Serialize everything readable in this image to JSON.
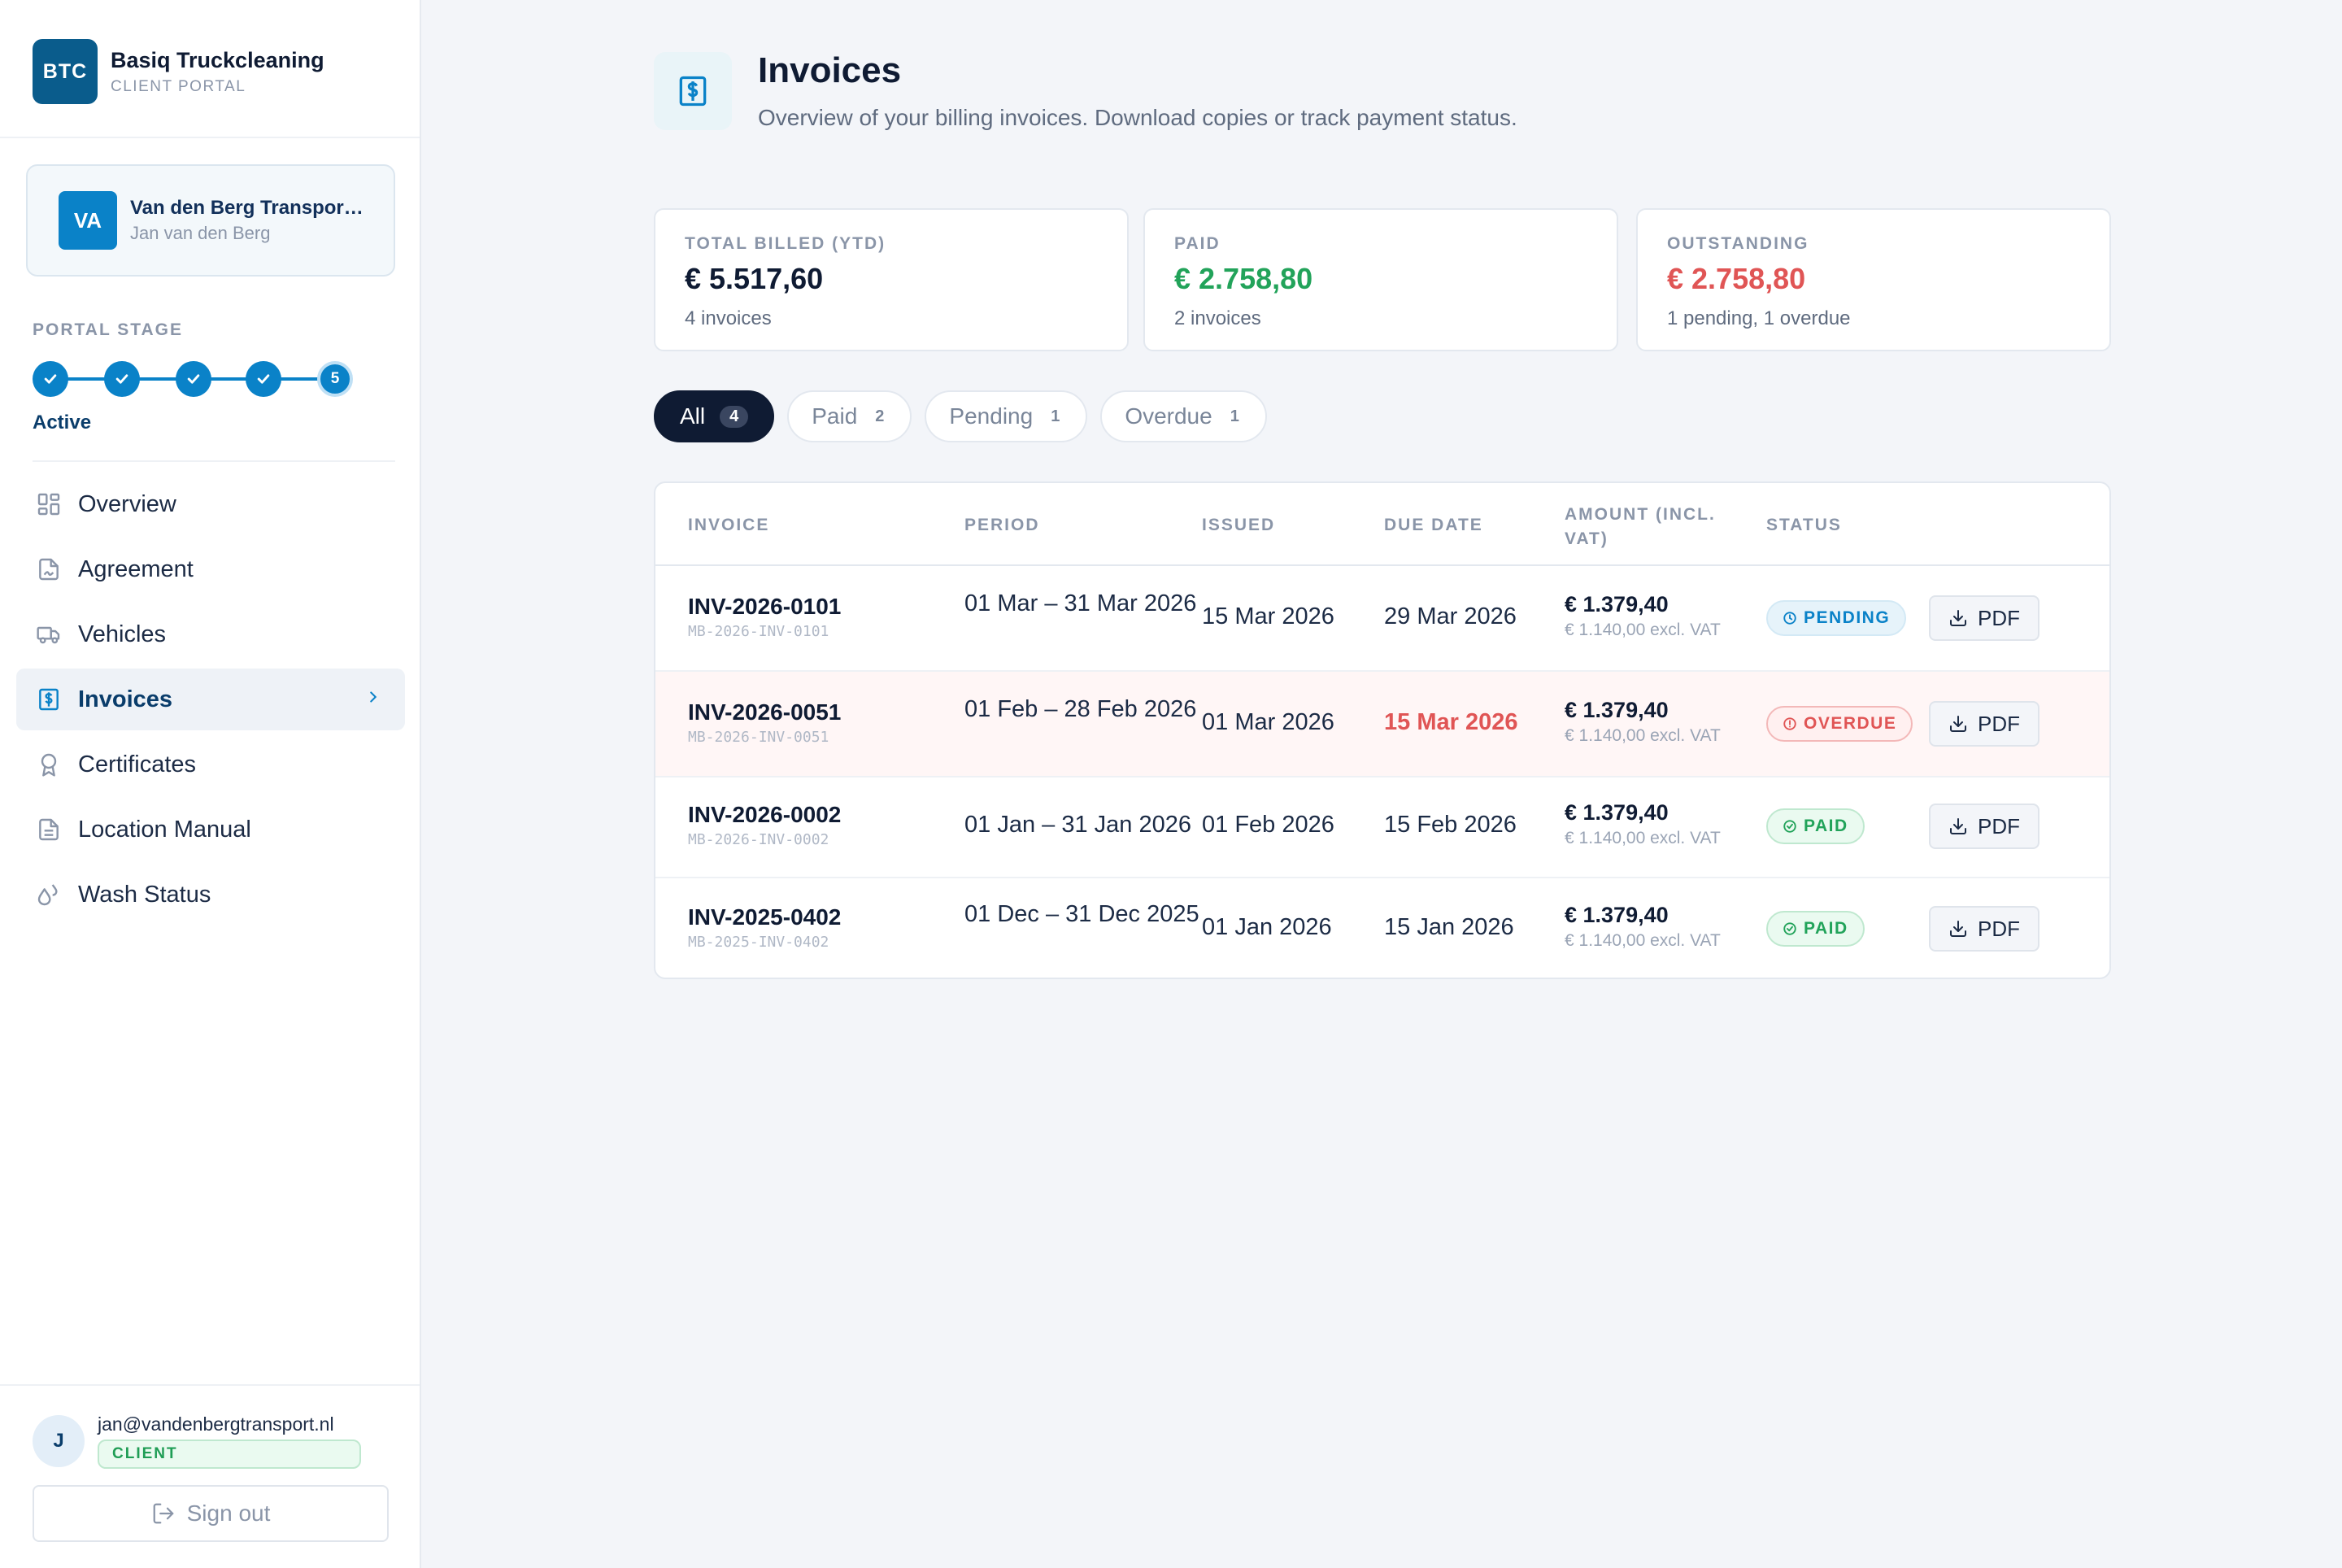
{
  "brand": {
    "logo": "BTC",
    "name": "Basiq Truckcleaning",
    "subtitle": "CLIENT PORTAL"
  },
  "client": {
    "initials": "VA",
    "company": "Van den Berg Transport B.V.",
    "contact": "Jan van den Berg"
  },
  "stage": {
    "label": "PORTAL STAGE",
    "current_step": "5",
    "status": "Active",
    "steps_completed": 4,
    "steps_total": 5
  },
  "nav": {
    "items": [
      {
        "label": "Overview",
        "icon": "grid-icon"
      },
      {
        "label": "Agreement",
        "icon": "signed-document-icon"
      },
      {
        "label": "Vehicles",
        "icon": "truck-icon"
      },
      {
        "label": "Invoices",
        "icon": "receipt-dollar-icon",
        "active": true
      },
      {
        "label": "Certificates",
        "icon": "award-icon"
      },
      {
        "label": "Location Manual",
        "icon": "document-icon"
      },
      {
        "label": "Wash Status",
        "icon": "droplets-icon"
      }
    ]
  },
  "user": {
    "initial": "J",
    "email": "jan@vandenbergtransport.nl",
    "role": "CLIENT",
    "signout_label": "Sign out"
  },
  "page": {
    "title": "Invoices",
    "description": "Overview of your billing invoices. Download copies or track payment status."
  },
  "stats": [
    {
      "label": "TOTAL BILLED (YTD)",
      "value": "€ 5.517,60",
      "note": "4 invoices",
      "color": "#0f1b33"
    },
    {
      "label": "PAID",
      "value": "€ 2.758,80",
      "note": "2 invoices",
      "color": "#22a35a"
    },
    {
      "label": "OUTSTANDING",
      "value": "€ 2.758,80",
      "note": "1 pending, 1 overdue",
      "color": "#e05555"
    }
  ],
  "filters": [
    {
      "label": "All",
      "count": "4",
      "active": true
    },
    {
      "label": "Paid",
      "count": "2"
    },
    {
      "label": "Pending",
      "count": "1"
    },
    {
      "label": "Overdue",
      "count": "1"
    }
  ],
  "table": {
    "headers": {
      "invoice": "INVOICE",
      "period": "PERIOD",
      "issued": "ISSUED",
      "due": "DUE DATE",
      "amount": "AMOUNT (INCL. VAT)",
      "status": "STATUS"
    },
    "pdf_label": "PDF",
    "rows": [
      {
        "number": "INV-2026-0101",
        "ref": "MB-2026-INV-0101",
        "period": "01 Mar – 31 Mar 2026",
        "issued": "15 Mar 2026",
        "due": "29 Mar 2026",
        "amount": "€ 1.379,40",
        "amount_excl": "€ 1.140,00 excl. VAT",
        "status": "PENDING"
      },
      {
        "number": "INV-2026-0051",
        "ref": "MB-2026-INV-0051",
        "period": "01 Feb – 28 Feb 2026",
        "issued": "01 Mar 2026",
        "due": "15 Mar 2026",
        "amount": "€ 1.379,40",
        "amount_excl": "€ 1.140,00 excl. VAT",
        "status": "OVERDUE"
      },
      {
        "number": "INV-2026-0002",
        "ref": "MB-2026-INV-0002",
        "period": "01 Jan – 31 Jan 2026",
        "issued": "01 Feb 2026",
        "due": "15 Feb 2026",
        "amount": "€ 1.379,40",
        "amount_excl": "€ 1.140,00 excl. VAT",
        "status": "PAID"
      },
      {
        "number": "INV-2025-0402",
        "ref": "MB-2025-INV-0402",
        "period": "01 Dec – 31 Dec 2025",
        "issued": "01 Jan 2026",
        "due": "15 Jan 2026",
        "amount": "€ 1.379,40",
        "amount_excl": "€ 1.140,00 excl. VAT",
        "status": "PAID"
      }
    ]
  },
  "colors": {
    "brand": "#0a5c8c",
    "accent": "#0a82c8",
    "paid": "#22a35a",
    "overdue": "#e05555",
    "dark": "#0f1b33"
  }
}
